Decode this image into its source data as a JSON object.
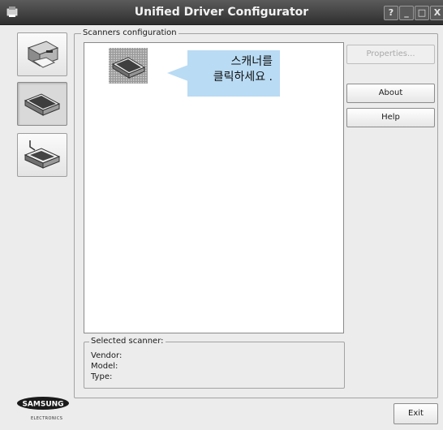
{
  "window": {
    "title": "Unified Driver Configurator"
  },
  "title_buttons": {
    "help": "?",
    "minimize": "_",
    "maximize": "□",
    "close": "X"
  },
  "sidebar": {
    "items": [
      {
        "name": "printers",
        "icon": "printer-icon"
      },
      {
        "name": "scanners",
        "icon": "scanner-icon",
        "active": true
      },
      {
        "name": "ports",
        "icon": "port-icon"
      }
    ]
  },
  "scanners": {
    "group_title": "Scanners configuration",
    "tooltip_line1": "스캐너를",
    "tooltip_line2": "클릭하세요 ."
  },
  "buttons": {
    "properties": "Properties...",
    "about": "About",
    "help": "Help",
    "exit": "Exit"
  },
  "selected": {
    "title": "Selected scanner:",
    "vendor": "Vendor:",
    "model": "Model:",
    "type": "Type:"
  },
  "brand": {
    "name": "SAMSUNG",
    "sub": "ELECTRONICS"
  }
}
